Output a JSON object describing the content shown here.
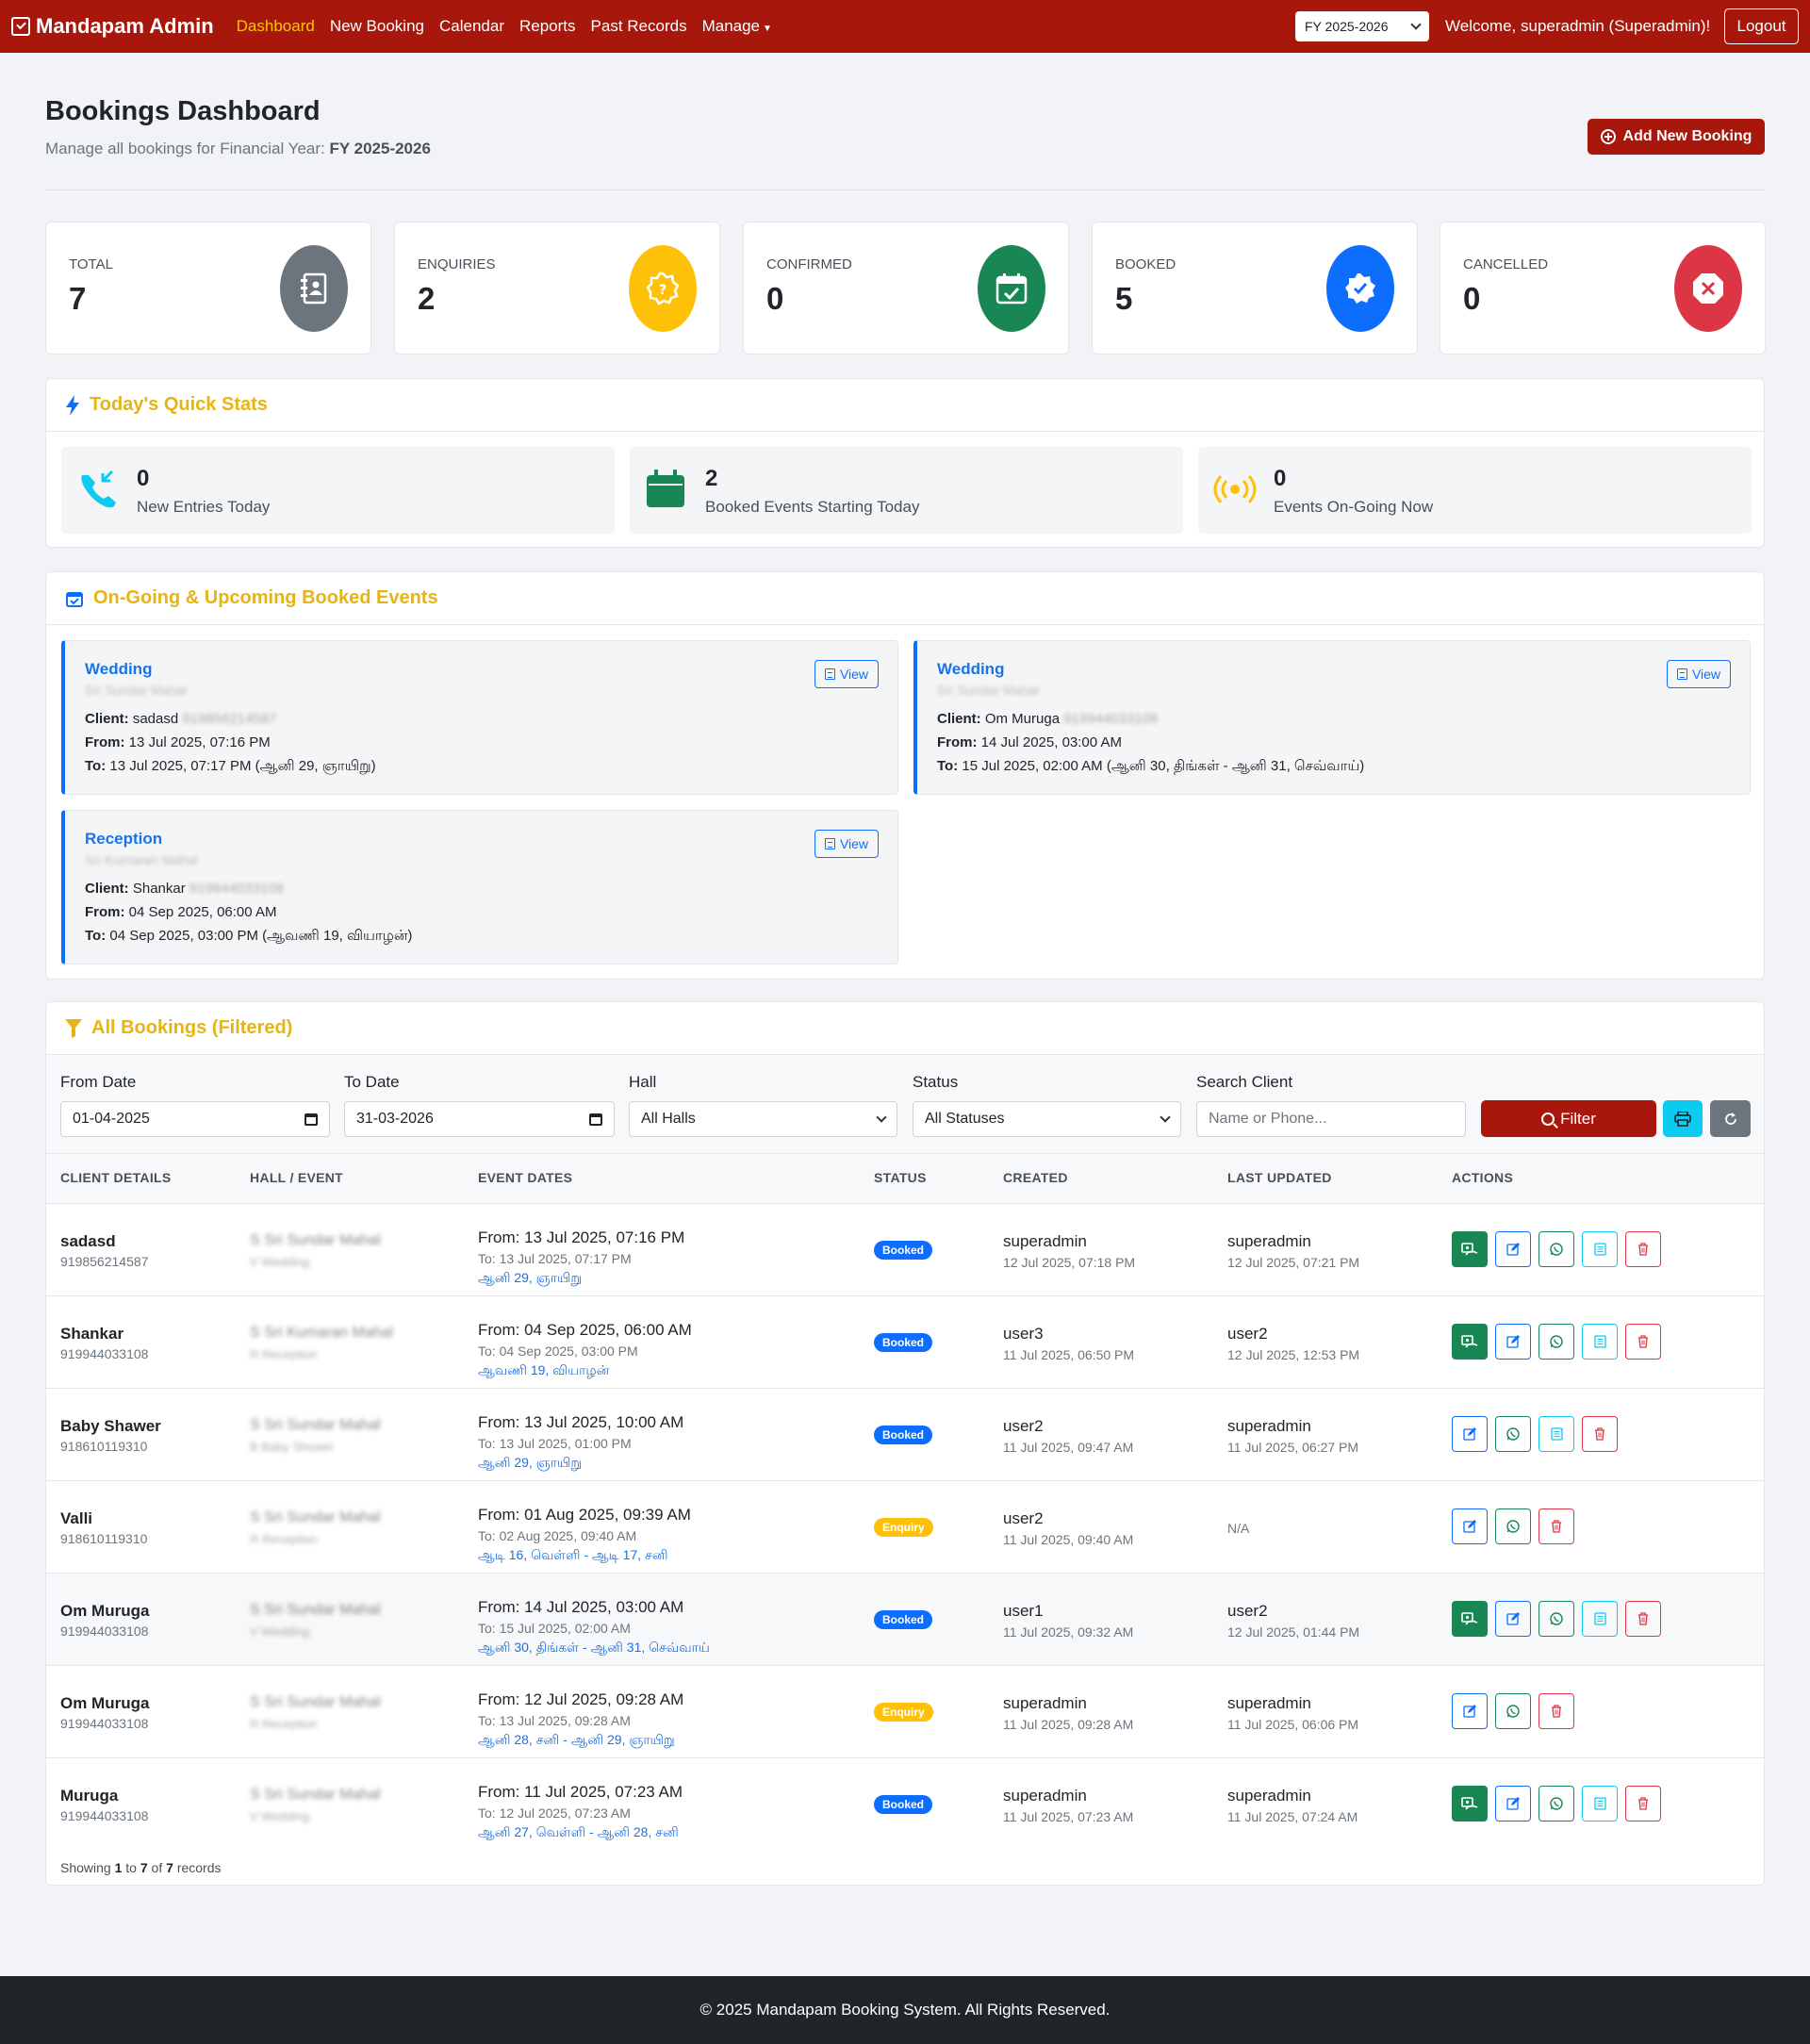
{
  "nav": {
    "brand": "Mandapam Admin",
    "links": [
      "Dashboard",
      "New Booking",
      "Calendar",
      "Reports",
      "Past Records",
      "Manage"
    ],
    "fy_select": "FY 2025-2026",
    "welcome": "Welcome, superadmin (Superadmin)!",
    "logout": "Logout"
  },
  "header": {
    "title": "Bookings Dashboard",
    "subtitle_prefix": "Manage all bookings for Financial Year:",
    "subtitle_fy": "FY 2025-2026",
    "add_button": "Add New Booking"
  },
  "stats": [
    {
      "label": "Total",
      "value": "7",
      "color": "#6c757d",
      "icon": "contact-book-icon"
    },
    {
      "label": "Enquiries",
      "value": "2",
      "color": "#ffc107",
      "icon": "question-badge-icon"
    },
    {
      "label": "Confirmed",
      "value": "0",
      "color": "#198754",
      "icon": "calendar-check-icon"
    },
    {
      "label": "Booked",
      "value": "5",
      "color": "#0d6efd",
      "icon": "patch-check-icon"
    },
    {
      "label": "Cancelled",
      "value": "0",
      "color": "#dc3545",
      "icon": "x-octagon-icon"
    }
  ],
  "quick_stats": {
    "title": "Today's Quick Stats",
    "items": [
      {
        "value": "0",
        "label": "New Entries Today",
        "icon": "phone-incoming-icon"
      },
      {
        "value": "2",
        "label": "Booked Events Starting Today",
        "icon": "calendar-icon"
      },
      {
        "value": "0",
        "label": "Events On-Going Now",
        "icon": "broadcast-icon"
      }
    ]
  },
  "upcoming": {
    "title": "On-Going & Upcoming Booked Events",
    "view_label": "View",
    "client_label": "Client:",
    "from_label": "From:",
    "to_label": "To:",
    "events": [
      {
        "type": "Wedding",
        "hall": "Sri Sundar Mahal",
        "client": "sadasd",
        "phone": "919856214587",
        "from": "13 Jul 2025, 07:16 PM",
        "to": "13 Jul 2025, 07:17 PM (ஆனி 29, ஞாயிறு)"
      },
      {
        "type": "Wedding",
        "hall": "Sri Sundar Mahal",
        "client": "Om Muruga",
        "phone": "919944033108",
        "from": "14 Jul 2025, 03:00 AM",
        "to": "15 Jul 2025, 02:00 AM (ஆனி 30, திங்கள் - ஆனி 31, செவ்வாய்)"
      },
      {
        "type": "Reception",
        "hall": "Sri Kumaran Mahal",
        "client": "Shankar",
        "phone": "919944033108",
        "from": "04 Sep 2025, 06:00 AM",
        "to": "04 Sep 2025, 03:00 PM (ஆவணி 19, வியாழன்)"
      }
    ]
  },
  "bookings": {
    "title": "All Bookings (Filtered)",
    "filters": {
      "from_label": "From Date",
      "from_value": "01-04-2025",
      "to_label": "To Date",
      "to_value": "31-03-2026",
      "hall_label": "Hall",
      "hall_value": "All Halls",
      "status_label": "Status",
      "status_value": "All Statuses",
      "search_label": "Search Client",
      "search_placeholder": "Name or Phone...",
      "filter_button": "Filter"
    },
    "columns": [
      "CLIENT DETAILS",
      "HALL / EVENT",
      "EVENT DATES",
      "STATUS",
      "CREATED",
      "LAST UPDATED",
      "ACTIONS"
    ],
    "rows": [
      {
        "name": "sadasd",
        "phone": "919856214587",
        "hall": "S Sri Sundar Mahal",
        "event": "V Wedding",
        "from": "From: 13 Jul 2025, 07:16 PM",
        "to": "To: 13 Jul 2025, 07:17 PM",
        "tamil": "ஆனி 29, ஞாயிறு",
        "status": "Booked",
        "created_by": "superadmin",
        "created_at": "12 Jul 2025, 07:18 PM",
        "updated_by": "superadmin",
        "updated_at": "12 Jul 2025, 07:21 PM"
      },
      {
        "name": "Shankar",
        "phone": "919944033108",
        "hall": "S Sri Kumaran Mahal",
        "event": "R Reception",
        "from": "From: 04 Sep 2025, 06:00 AM",
        "to": "To: 04 Sep 2025, 03:00 PM",
        "tamil": "ஆவணி 19, வியாழன்",
        "status": "Booked",
        "created_by": "user3",
        "created_at": "11 Jul 2025, 06:50 PM",
        "updated_by": "user2",
        "updated_at": "12 Jul 2025, 12:53 PM"
      },
      {
        "name": "Baby Shawer",
        "phone": "918610119310",
        "hall": "S Sri Sundar Mahal",
        "event": "B Baby Shower",
        "from": "From: 13 Jul 2025, 10:00 AM",
        "to": "To: 13 Jul 2025, 01:00 PM",
        "tamil": "ஆனி 29, ஞாயிறு",
        "status": "Booked",
        "created_by": "user2",
        "created_at": "11 Jul 2025, 09:47 AM",
        "updated_by": "superadmin",
        "updated_at": "11 Jul 2025, 06:27 PM"
      },
      {
        "name": "Valli",
        "phone": "918610119310",
        "hall": "S Sri Sundar Mahal",
        "event": "R Reception",
        "from": "From: 01 Aug 2025, 09:39 AM",
        "to": "To: 02 Aug 2025, 09:40 AM",
        "tamil": "ஆடி 16, வெள்ளி - ஆடி 17, சனி",
        "status": "Enquiry",
        "created_by": "user2",
        "created_at": "11 Jul 2025, 09:40 AM",
        "updated_by": "",
        "updated_at": "N/A"
      },
      {
        "name": "Om Muruga",
        "phone": "919944033108",
        "hall": "S Sri Sundar Mahal",
        "event": "V Wedding",
        "from": "From: 14 Jul 2025, 03:00 AM",
        "to": "To: 15 Jul 2025, 02:00 AM",
        "tamil": "ஆனி 30, திங்கள் - ஆனி 31, செவ்வாய்",
        "status": "Booked",
        "created_by": "user1",
        "created_at": "11 Jul 2025, 09:32 AM",
        "updated_by": "user2",
        "updated_at": "12 Jul 2025, 01:44 PM"
      },
      {
        "name": "Om Muruga",
        "phone": "919944033108",
        "hall": "S Sri Sundar Mahal",
        "event": "R Reception",
        "from": "From: 12 Jul 2025, 09:28 AM",
        "to": "To: 13 Jul 2025, 09:28 AM",
        "tamil": "ஆனி 28, சனி - ஆனி 29, ஞாயிறு",
        "status": "Enquiry",
        "created_by": "superadmin",
        "created_at": "11 Jul 2025, 09:28 AM",
        "updated_by": "superadmin",
        "updated_at": "11 Jul 2025, 06:06 PM"
      },
      {
        "name": "Muruga",
        "phone": "919944033108",
        "hall": "S Sri Sundar Mahal",
        "event": "V Wedding",
        "from": "From: 11 Jul 2025, 07:23 AM",
        "to": "To: 12 Jul 2025, 07:23 AM",
        "tamil": "ஆனி 27, வெள்ளி - ஆனி 28, சனி",
        "status": "Booked",
        "created_by": "superadmin",
        "created_at": "11 Jul 2025, 07:23 AM",
        "updated_by": "superadmin",
        "updated_at": "11 Jul 2025, 07:24 AM"
      }
    ],
    "showing_prefix": "Showing",
    "showing_from": "1",
    "showing_mid": "to",
    "showing_to": "7",
    "showing_of": "of",
    "showing_total": "7",
    "showing_suffix": "records"
  },
  "footer": "© 2025 Mandapam Booking System. All Rights Reserved."
}
